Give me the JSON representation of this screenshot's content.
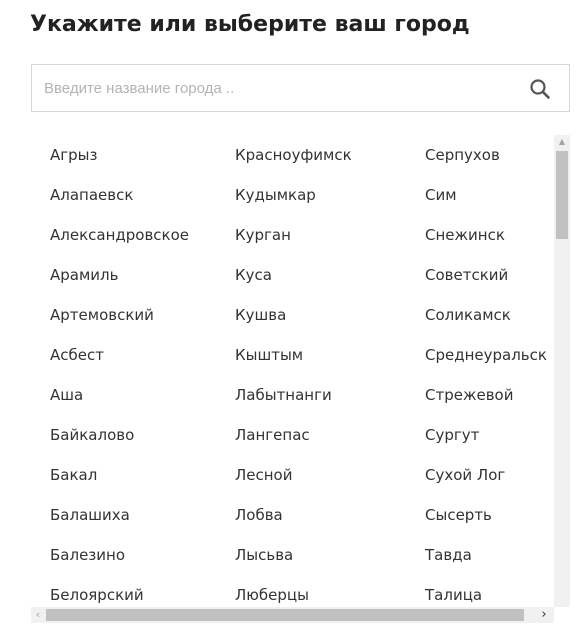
{
  "header": {
    "title": "Укажите или выберите ваш город"
  },
  "search": {
    "placeholder": "Введите название города ..",
    "value": "",
    "icon": "search-icon"
  },
  "cities": {
    "columns": [
      [
        "Агрыз",
        "Алапаевск",
        "Александровское",
        "Арамиль",
        "Артемовский",
        "Асбест",
        "Аша",
        "Байкалово",
        "Бакал",
        "Балашиха",
        "Балезино",
        "Белоярский"
      ],
      [
        "Красноуфимск",
        "Кудымкар",
        "Курган",
        "Куса",
        "Кушва",
        "Кыштым",
        "Лабытнанги",
        "Лангепас",
        "Лесной",
        "Лобва",
        "Лысьва",
        "Люберцы"
      ],
      [
        "Серпухов",
        "Сим",
        "Снежинск",
        "Советский",
        "Соликамск",
        "Среднеуральск",
        "Стрежевой",
        "Сургут",
        "Сухой Лог",
        "Сысерть",
        "Тавда",
        "Талица"
      ]
    ]
  },
  "scrollbars": {
    "vertical_arrow_up": "▲",
    "horizontal_arrow_left": "‹",
    "horizontal_arrow_right": "›",
    "vertical_position": 0.0,
    "horizontal_position": 0.0
  },
  "colors": {
    "text": "#333333",
    "placeholder": "#b4b4b4",
    "border": "#d8d8d8",
    "scroll_thumb": "#c1c1c1",
    "scroll_track": "#f1f1f1"
  }
}
